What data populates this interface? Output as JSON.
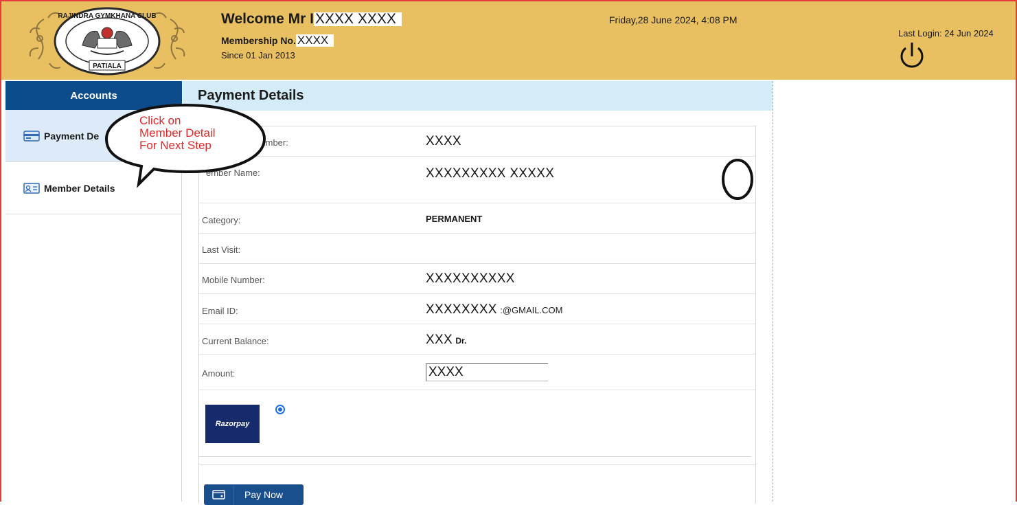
{
  "header": {
    "logo_text_top": "RAJINDRA GYMKHANA CLUB",
    "logo_text_bottom": "PATIALA",
    "welcome_prefix": "Welcome Mr I",
    "welcome_name": "XXXX XXXX",
    "membership_label": "Membership No.",
    "membership_no": "XXXX",
    "since": "Since 01 Jan 2013",
    "datetime": "Friday,28 June 2024, 4:08 PM",
    "last_login": "Last Login: 24 Jun 2024",
    "header_color": "#e8c061"
  },
  "sidebar": {
    "title": "Accounts",
    "items": [
      {
        "label": "Payment De",
        "icon": "card-icon",
        "active": true
      },
      {
        "label": "Member Details",
        "icon": "id-card-icon",
        "active": false
      }
    ]
  },
  "main": {
    "title": "Payment Details",
    "fields": [
      {
        "label": "Number:",
        "value": "XXXX"
      },
      {
        "label": "ember Name:",
        "value": "XXXXXXXXX XXXXX"
      },
      {
        "label": "Category:",
        "value": "PERMANENT"
      },
      {
        "label": "Last Visit:",
        "value": ""
      },
      {
        "label": "Mobile Number:",
        "value": "XXXXXXXXXX"
      },
      {
        "label": "Email ID:",
        "value": "XXXXXXXX",
        "suffix": ":@GMAIL.COM"
      },
      {
        "label": "Current Balance:",
        "value": "XXX",
        "suffix": "Dr."
      },
      {
        "label": "Amount:",
        "value": "XXXX"
      }
    ],
    "gateway_label": "Razorpay",
    "pay_button": "Pay Now"
  },
  "callout": {
    "line1": "Click on",
    "line2": "Member Detail",
    "line3": "For Next Step",
    "color": "#e02a2a"
  }
}
